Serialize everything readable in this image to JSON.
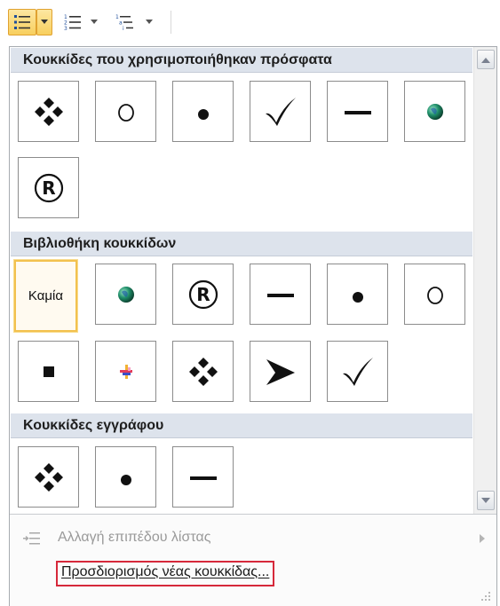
{
  "sections": {
    "recent": {
      "title": "Κουκκίδες που χρησιμοποιήθηκαν πρόσφατα"
    },
    "library": {
      "title": "Βιβλιοθήκη κουκκίδων",
      "none_label": "Καμία"
    },
    "document": {
      "title": "Κουκκίδες εγγράφου"
    }
  },
  "menu": {
    "change_level": "Αλλαγή επιπέδου λίστας",
    "define_new": "Προσδιορισμός νέας κουκκίδας..."
  },
  "colors": {
    "highlight": "#f2c14e",
    "outline": "#d6283a",
    "header_bg": "#dde3ec"
  }
}
